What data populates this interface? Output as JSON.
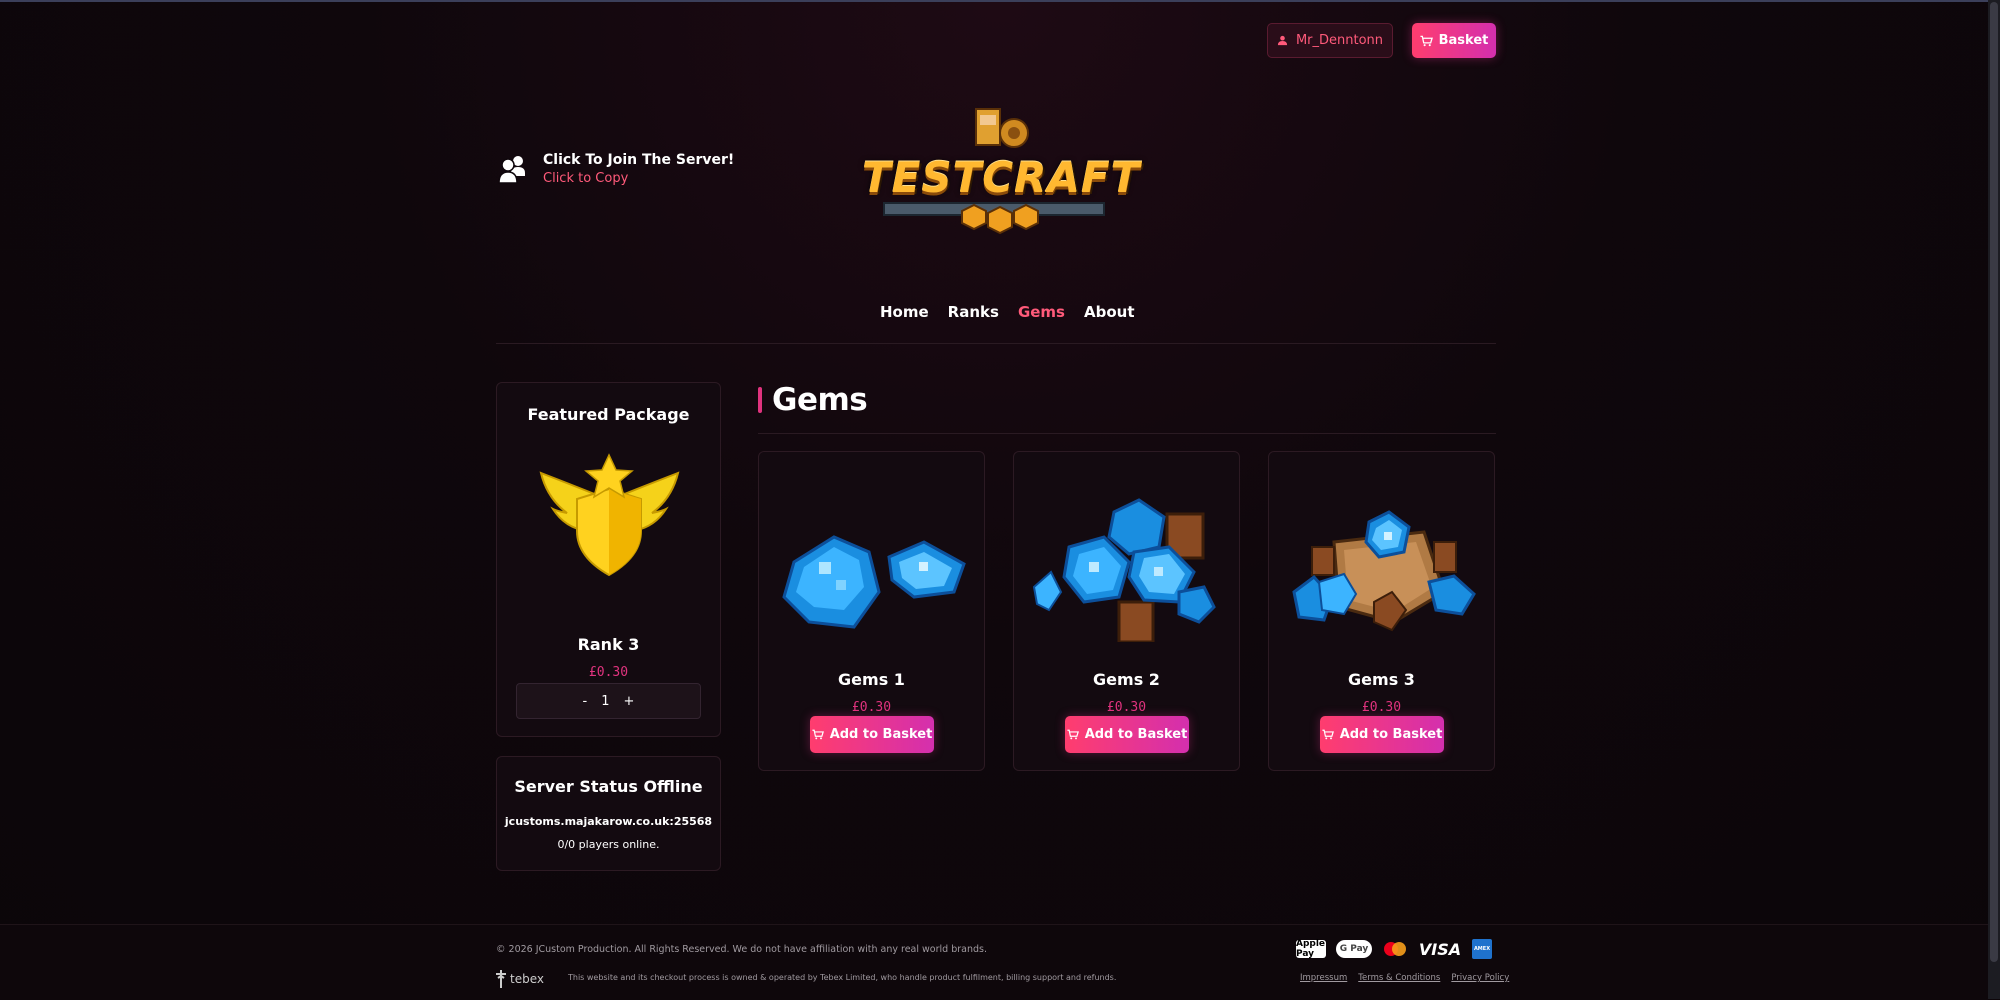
{
  "header": {
    "username": "Mr_Denntonn",
    "basket_label": "Basket"
  },
  "join": {
    "title": "Click To Join The Server!",
    "subtitle": "Click to Copy"
  },
  "logo": {
    "text": "TESTCRAFT"
  },
  "nav": {
    "items": [
      "Home",
      "Ranks",
      "Gems",
      "About"
    ],
    "active": "Gems"
  },
  "featured": {
    "heading": "Featured Package",
    "name": "Rank 3",
    "price": "£0.30",
    "qty_minus": "-",
    "qty_value": "1",
    "qty_plus": "+"
  },
  "status": {
    "title": "Server Status Offline",
    "host": "jcustoms.majakarow.co.uk:25568",
    "players": "0/0 players online."
  },
  "section": {
    "title": "Gems"
  },
  "products": [
    {
      "name": "Gems 1",
      "price": "£0.30",
      "button": "Add to Basket"
    },
    {
      "name": "Gems 2",
      "price": "£0.30",
      "button": "Add to Basket"
    },
    {
      "name": "Gems 3",
      "price": "£0.30",
      "button": "Add to Basket"
    }
  ],
  "footer": {
    "copyright": "© 2026 JCustom Production. All Rights Reserved. We do not have affiliation with any real world brands.",
    "tebex": "tebex",
    "legal": "This website and its checkout process is owned & operated by Tebex Limited, who handle product fulfilment, billing support and refunds.",
    "payments": [
      "Apple Pay",
      "G Pay",
      "Mastercard",
      "VISA",
      "AMEX"
    ],
    "links": [
      "Impressum",
      "Terms & Conditions",
      "Privacy Policy"
    ]
  },
  "colors": {
    "accent": "#ff5a7a",
    "price": "#e0337e",
    "button_gradient": [
      "#ff3d6e",
      "#d42fae"
    ]
  }
}
